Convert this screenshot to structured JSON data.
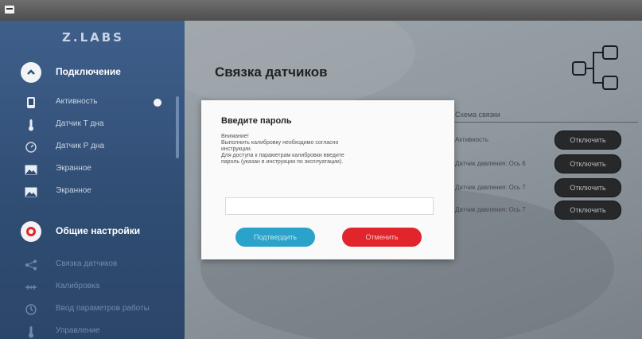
{
  "app": {
    "logo": "Z.LABS"
  },
  "sidebar": {
    "section_connect": {
      "title": "Подключение",
      "icon": "chevron-up-icon"
    },
    "items_connect": [
      {
        "label": "Активность",
        "icon": "device-icon"
      },
      {
        "label": "Датчик Т дна",
        "icon": "thermometer-icon"
      },
      {
        "label": "Датчик Р дна",
        "icon": "gauge-icon"
      },
      {
        "label": "Экранное",
        "icon": "image-icon"
      },
      {
        "label": "Экранное",
        "icon": "image-icon"
      }
    ],
    "section_general": {
      "title": "Общие настройки",
      "icon": "target-icon"
    },
    "items_general": [
      {
        "label": "Связка датчиков",
        "icon": "share-icon"
      },
      {
        "label": "Калибровка",
        "icon": "calibration-icon"
      },
      {
        "label": "Ввод параметров работы",
        "icon": "clock-icon"
      },
      {
        "label": "Управление",
        "icon": "thermometer-icon"
      }
    ]
  },
  "main": {
    "title": "Связка датчиков",
    "right_panel": {
      "header": "Схема связки",
      "rows": [
        {
          "text": "Активность",
          "button": "Отключить"
        },
        {
          "text": "Датчик давления: Ось 6",
          "button": "Отключить"
        },
        {
          "text": "Датчик давления: Ось 7",
          "button": "Отключить"
        },
        {
          "text": "Датчик давления: Ось 7",
          "button": "Отключить"
        }
      ]
    }
  },
  "dialog": {
    "title": "Введите пароль",
    "body_lines": [
      "Внимание!",
      "Выполнить калибровку необходимо согласно",
      "инструкции.",
      "Для доступа к параметрам калибровки введите",
      "пароль (указан в инструкции по эксплуатации)."
    ],
    "password_value": "",
    "confirm_label": "Подтвердить",
    "cancel_label": "Отменить"
  },
  "colors": {
    "sidebar": "#3f5f8b",
    "confirm": "#2aa2c9",
    "cancel": "#e0262c",
    "button_dark": "#2a2a2a"
  }
}
